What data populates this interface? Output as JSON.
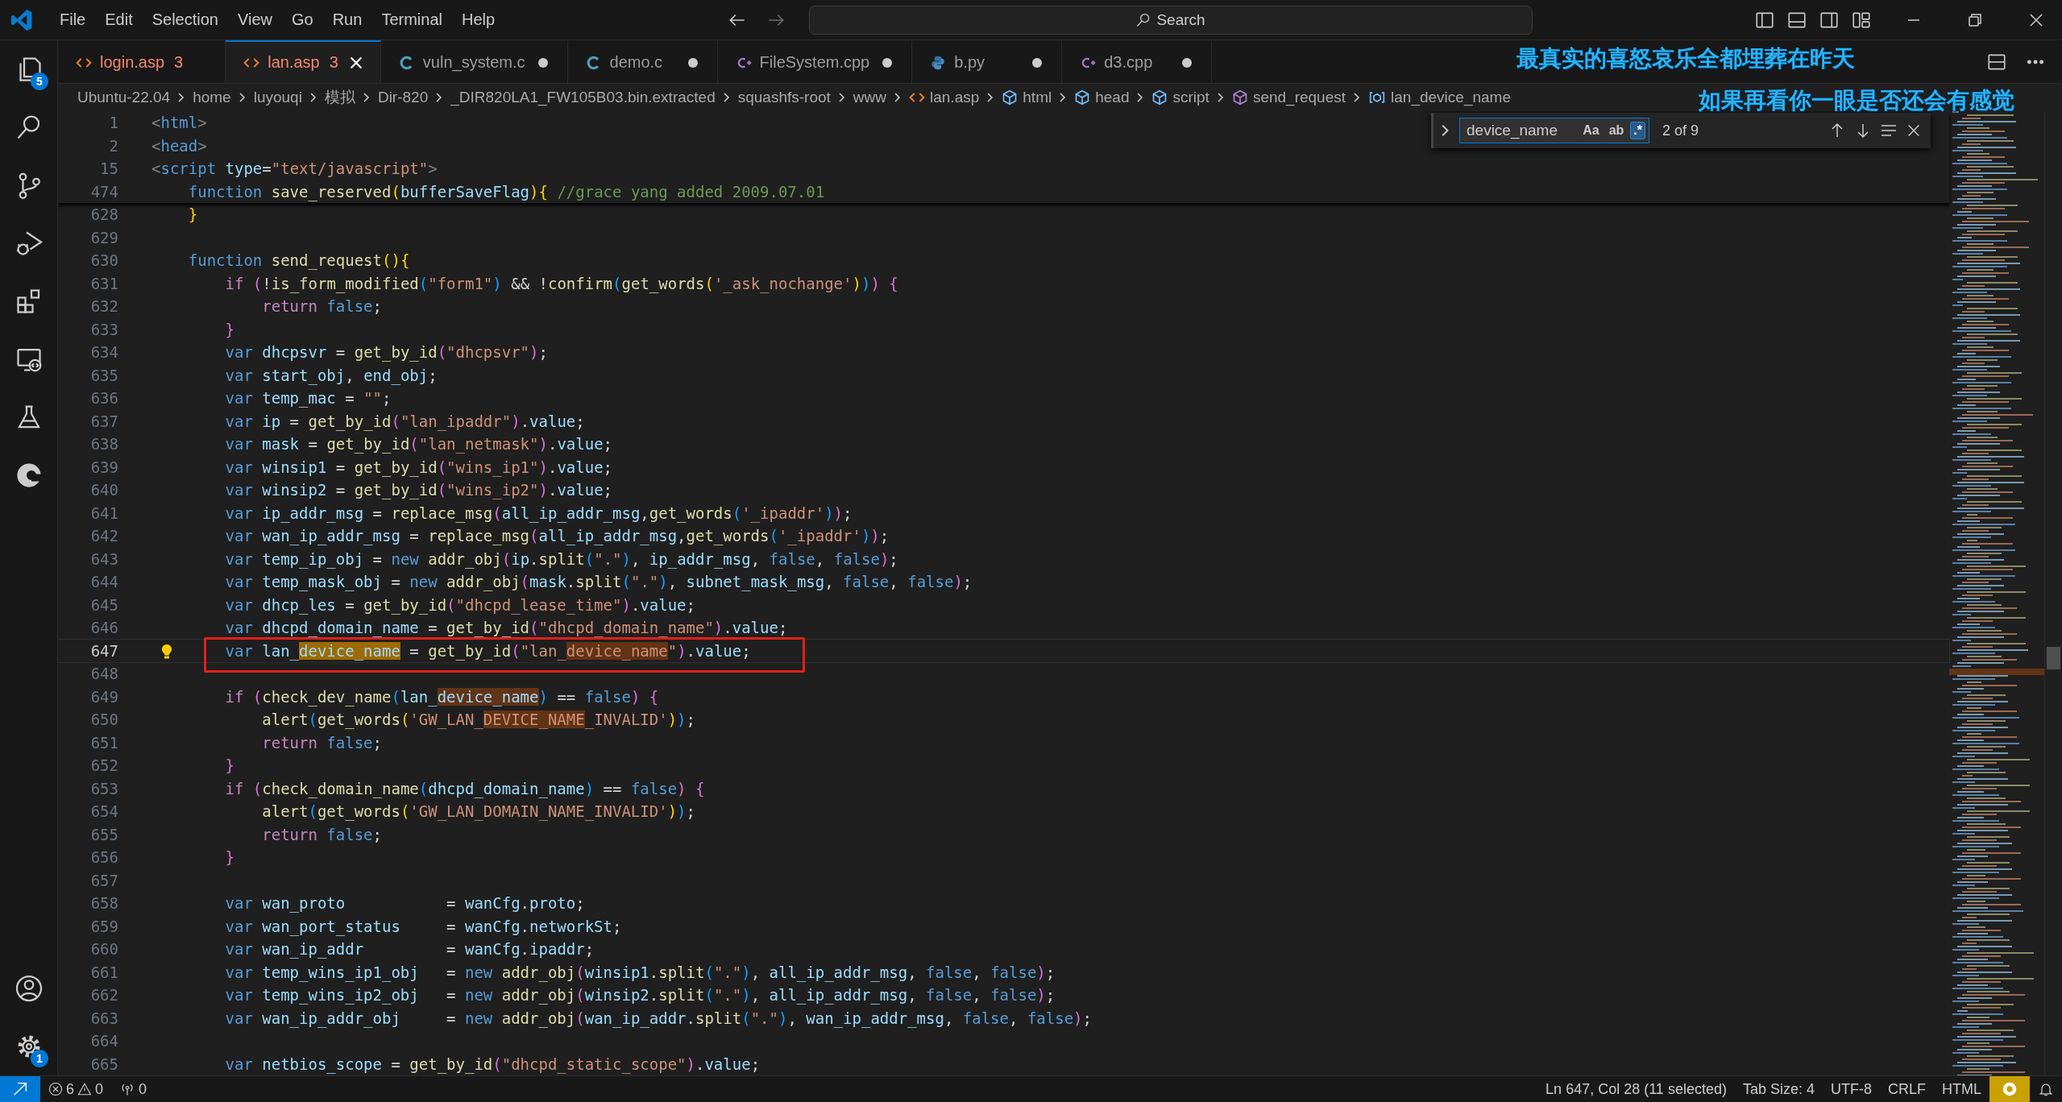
{
  "menu": [
    "File",
    "Edit",
    "Selection",
    "View",
    "Go",
    "Run",
    "Terminal",
    "Help"
  ],
  "command_center": {
    "placeholder": "Search"
  },
  "activity_bar": {
    "items": [
      {
        "kind": "explorer",
        "badge": "5"
      },
      {
        "kind": "search"
      },
      {
        "kind": "source-control"
      },
      {
        "kind": "run-debug"
      },
      {
        "kind": "extensions"
      },
      {
        "kind": "remote"
      },
      {
        "kind": "testing"
      },
      {
        "kind": "round"
      }
    ],
    "bottom": [
      {
        "kind": "account"
      },
      {
        "kind": "settings",
        "badge": "1"
      }
    ]
  },
  "tabs": [
    {
      "label": "login.asp",
      "kind": "html",
      "problems": "3",
      "modified": false,
      "selected": false,
      "has_errors": true
    },
    {
      "label": "lan.asp",
      "kind": "html",
      "problems": "3",
      "modified": false,
      "selected": true,
      "has_errors": true
    },
    {
      "label": "vuln_system.c",
      "kind": "c",
      "modified": true,
      "selected": false,
      "has_errors": false
    },
    {
      "label": "demo.c",
      "kind": "c",
      "modified": true,
      "selected": false,
      "has_errors": false
    },
    {
      "label": "FileSystem.cpp",
      "kind": "cpp",
      "modified": true,
      "selected": false,
      "has_errors": false
    },
    {
      "label": "b.py",
      "kind": "python",
      "modified": true,
      "selected": false,
      "has_errors": false
    },
    {
      "label": "d3.cpp",
      "kind": "cpp",
      "modified": true,
      "selected": false,
      "has_errors": false
    }
  ],
  "breadcrumbs": [
    {
      "text": "Ubuntu-22.04",
      "kind": "folder"
    },
    {
      "text": "home",
      "kind": "folder"
    },
    {
      "text": "luyouqi",
      "kind": "folder"
    },
    {
      "text": "模拟",
      "kind": "folder"
    },
    {
      "text": "Dir-820",
      "kind": "folder"
    },
    {
      "text": "_DIR820LA1_FW105B03.bin.extracted",
      "kind": "folder"
    },
    {
      "text": "squashfs-root",
      "kind": "folder"
    },
    {
      "text": "www",
      "kind": "folder"
    },
    {
      "text": "lan.asp",
      "kind": "html"
    },
    {
      "text": "html",
      "kind": "element"
    },
    {
      "text": "head",
      "kind": "element"
    },
    {
      "text": "script",
      "kind": "element"
    },
    {
      "text": "send_request",
      "kind": "method"
    },
    {
      "text": "lan_device_name",
      "kind": "variable"
    }
  ],
  "lyrics": [
    "最真实的喜怒哀乐全都埋葬在昨天",
    "如果再看你一眼是否还会有感觉"
  ],
  "find": {
    "value": "device_name",
    "toggles": [
      {
        "label": "Aa",
        "on": false
      },
      {
        "label": "ab",
        "on": false
      },
      {
        "label": ".*",
        "on": true
      }
    ],
    "count": "2 of 9"
  },
  "editor": {
    "sticky_lines": [
      {
        "n": "1",
        "tokens": [
          {
            "kind": "tagp",
            "text": "<"
          },
          {
            "kind": "tag",
            "text": "html"
          },
          {
            "kind": "tagp",
            "text": ">"
          }
        ]
      },
      {
        "n": "2",
        "tokens": [
          {
            "kind": "tagp",
            "text": "<"
          },
          {
            "kind": "tag",
            "text": "head"
          },
          {
            "kind": "tagp",
            "text": ">"
          }
        ]
      },
      {
        "n": "15",
        "tokens": [
          {
            "kind": "tagp",
            "text": "<"
          },
          {
            "kind": "tag",
            "text": "script "
          },
          {
            "kind": "attr",
            "text": "type"
          },
          {
            "kind": "p",
            "text": "="
          },
          {
            "kind": "str",
            "text": "\"text/javascript\""
          },
          {
            "kind": "tagp",
            "text": ">"
          }
        ]
      },
      {
        "n": "474",
        "tokens": [
          {
            "kind": "kw",
            "text": "    function "
          },
          {
            "kind": "fn",
            "text": "save_reserved"
          },
          {
            "kind": "b1",
            "text": "("
          },
          {
            "kind": "var",
            "text": "bufferSaveFlag"
          },
          {
            "kind": "b1",
            "text": "){ "
          },
          {
            "kind": "cm",
            "text": "//grace yang added 2009.07.01"
          }
        ]
      }
    ],
    "lines": [
      {
        "n": "628",
        "current": false,
        "tokens": [
          {
            "kind": "b1",
            "text": "    }"
          }
        ]
      },
      {
        "n": "629",
        "current": false
      },
      {
        "n": "630",
        "current": false,
        "tokens": [
          {
            "kind": "kw",
            "text": "    function "
          },
          {
            "kind": "fn",
            "text": "send_request"
          },
          {
            "kind": "b1",
            "text": "(){"
          }
        ]
      },
      {
        "n": "631",
        "current": false,
        "tokens": [
          {
            "kind": "ctl",
            "text": "        if "
          },
          {
            "kind": "b2",
            "text": "("
          },
          {
            "kind": "p",
            "text": "!"
          },
          {
            "kind": "fn",
            "text": "is_form_modified"
          },
          {
            "kind": "b3",
            "text": "("
          },
          {
            "kind": "str",
            "text": "\"form1\""
          },
          {
            "kind": "b3",
            "text": ")"
          },
          {
            "kind": "p",
            "text": " && !"
          },
          {
            "kind": "fn",
            "text": "confirm"
          },
          {
            "kind": "b3",
            "text": "("
          },
          {
            "kind": "fn",
            "text": "get_words"
          },
          {
            "kind": "b1",
            "text": "("
          },
          {
            "kind": "str",
            "text": "'_ask_nochange'"
          },
          {
            "kind": "b1",
            "text": ")"
          },
          {
            "kind": "b3",
            "text": ")"
          },
          {
            "kind": "b2",
            "text": ") {"
          }
        ]
      },
      {
        "n": "632",
        "current": false,
        "tokens": [
          {
            "kind": "ctl",
            "text": "            return "
          },
          {
            "kind": "const",
            "text": "false"
          },
          {
            "kind": "p",
            "text": ";"
          }
        ]
      },
      {
        "n": "633",
        "current": false,
        "tokens": [
          {
            "kind": "b2",
            "text": "        }"
          }
        ]
      },
      {
        "n": "634",
        "current": false,
        "tokens": [
          {
            "kind": "kw",
            "text": "        var "
          },
          {
            "kind": "var",
            "text": "dhcpsvr"
          },
          {
            "kind": "p",
            "text": " = "
          },
          {
            "kind": "fn",
            "text": "get_by_id"
          },
          {
            "kind": "b2",
            "text": "("
          },
          {
            "kind": "str",
            "text": "\"dhcpsvr\""
          },
          {
            "kind": "b2",
            "text": ")"
          },
          {
            "kind": "p",
            "text": ";"
          }
        ]
      },
      {
        "n": "635",
        "current": false,
        "tokens": [
          {
            "kind": "kw",
            "text": "        var "
          },
          {
            "kind": "var",
            "text": "start_obj"
          },
          {
            "kind": "p",
            "text": ", "
          },
          {
            "kind": "var",
            "text": "end_obj"
          },
          {
            "kind": "p",
            "text": ";"
          }
        ]
      },
      {
        "n": "636",
        "current": false,
        "tokens": [
          {
            "kind": "kw",
            "text": "        var "
          },
          {
            "kind": "var",
            "text": "temp_mac"
          },
          {
            "kind": "p",
            "text": " = "
          },
          {
            "kind": "str",
            "text": "\"\""
          },
          {
            "kind": "p",
            "text": ";"
          }
        ]
      },
      {
        "n": "637",
        "current": false,
        "tokens": [
          {
            "kind": "kw",
            "text": "        var "
          },
          {
            "kind": "var",
            "text": "ip"
          },
          {
            "kind": "p",
            "text": " = "
          },
          {
            "kind": "fn",
            "text": "get_by_id"
          },
          {
            "kind": "b2",
            "text": "("
          },
          {
            "kind": "str",
            "text": "\"lan_ipaddr\""
          },
          {
            "kind": "b2",
            "text": ")"
          },
          {
            "kind": "p",
            "text": "."
          },
          {
            "kind": "var",
            "text": "value"
          },
          {
            "kind": "p",
            "text": ";"
          }
        ]
      },
      {
        "n": "638",
        "current": false,
        "tokens": [
          {
            "kind": "kw",
            "text": "        var "
          },
          {
            "kind": "var",
            "text": "mask"
          },
          {
            "kind": "p",
            "text": " = "
          },
          {
            "kind": "fn",
            "text": "get_by_id"
          },
          {
            "kind": "b2",
            "text": "("
          },
          {
            "kind": "str",
            "text": "\"lan_netmask\""
          },
          {
            "kind": "b2",
            "text": ")"
          },
          {
            "kind": "p",
            "text": "."
          },
          {
            "kind": "var",
            "text": "value"
          },
          {
            "kind": "p",
            "text": ";"
          }
        ]
      },
      {
        "n": "639",
        "current": false,
        "tokens": [
          {
            "kind": "kw",
            "text": "        var "
          },
          {
            "kind": "var",
            "text": "winsip1"
          },
          {
            "kind": "p",
            "text": " = "
          },
          {
            "kind": "fn",
            "text": "get_by_id"
          },
          {
            "kind": "b2",
            "text": "("
          },
          {
            "kind": "str",
            "text": "\"wins_ip1\""
          },
          {
            "kind": "b2",
            "text": ")"
          },
          {
            "kind": "p",
            "text": "."
          },
          {
            "kind": "var",
            "text": "value"
          },
          {
            "kind": "p",
            "text": ";"
          }
        ]
      },
      {
        "n": "640",
        "current": false,
        "tokens": [
          {
            "kind": "kw",
            "text": "        var "
          },
          {
            "kind": "var",
            "text": "winsip2"
          },
          {
            "kind": "p",
            "text": " = "
          },
          {
            "kind": "fn",
            "text": "get_by_id"
          },
          {
            "kind": "b2",
            "text": "("
          },
          {
            "kind": "str",
            "text": "\"wins_ip2\""
          },
          {
            "kind": "b2",
            "text": ")"
          },
          {
            "kind": "p",
            "text": "."
          },
          {
            "kind": "var",
            "text": "value"
          },
          {
            "kind": "p",
            "text": ";"
          }
        ]
      },
      {
        "n": "641",
        "current": false,
        "tokens": [
          {
            "kind": "kw",
            "text": "        var "
          },
          {
            "kind": "var",
            "text": "ip_addr_msg"
          },
          {
            "kind": "p",
            "text": " = "
          },
          {
            "kind": "fn",
            "text": "replace_msg"
          },
          {
            "kind": "b2",
            "text": "("
          },
          {
            "kind": "var",
            "text": "all_ip_addr_msg"
          },
          {
            "kind": "p",
            "text": ","
          },
          {
            "kind": "fn",
            "text": "get_words"
          },
          {
            "kind": "b3",
            "text": "("
          },
          {
            "kind": "str",
            "text": "'_ipaddr'"
          },
          {
            "kind": "b3",
            "text": ")"
          },
          {
            "kind": "b2",
            "text": ")"
          },
          {
            "kind": "p",
            "text": ";"
          }
        ]
      },
      {
        "n": "642",
        "current": false,
        "tokens": [
          {
            "kind": "kw",
            "text": "        var "
          },
          {
            "kind": "var",
            "text": "wan_ip_addr_msg"
          },
          {
            "kind": "p",
            "text": " = "
          },
          {
            "kind": "fn",
            "text": "replace_msg"
          },
          {
            "kind": "b2",
            "text": "("
          },
          {
            "kind": "var",
            "text": "all_ip_addr_msg"
          },
          {
            "kind": "p",
            "text": ","
          },
          {
            "kind": "fn",
            "text": "get_words"
          },
          {
            "kind": "b3",
            "text": "("
          },
          {
            "kind": "str",
            "text": "'_ipaddr'"
          },
          {
            "kind": "b3",
            "text": ")"
          },
          {
            "kind": "b2",
            "text": ")"
          },
          {
            "kind": "p",
            "text": ";"
          }
        ]
      },
      {
        "n": "643",
        "current": false,
        "tokens": [
          {
            "kind": "kw",
            "text": "        var "
          },
          {
            "kind": "var",
            "text": "temp_ip_obj"
          },
          {
            "kind": "p",
            "text": " = "
          },
          {
            "kind": "kw",
            "text": "new "
          },
          {
            "kind": "fn",
            "text": "addr_obj"
          },
          {
            "kind": "b2",
            "text": "("
          },
          {
            "kind": "var",
            "text": "ip"
          },
          {
            "kind": "p",
            "text": "."
          },
          {
            "kind": "fn",
            "text": "split"
          },
          {
            "kind": "b3",
            "text": "("
          },
          {
            "kind": "str",
            "text": "\".\""
          },
          {
            "kind": "b3",
            "text": ")"
          },
          {
            "kind": "p",
            "text": ", "
          },
          {
            "kind": "var",
            "text": "ip_addr_msg"
          },
          {
            "kind": "p",
            "text": ", "
          },
          {
            "kind": "const",
            "text": "false"
          },
          {
            "kind": "p",
            "text": ", "
          },
          {
            "kind": "const",
            "text": "false"
          },
          {
            "kind": "b2",
            "text": ")"
          },
          {
            "kind": "p",
            "text": ";"
          }
        ]
      },
      {
        "n": "644",
        "current": false,
        "tokens": [
          {
            "kind": "kw",
            "text": "        var "
          },
          {
            "kind": "var",
            "text": "temp_mask_obj"
          },
          {
            "kind": "p",
            "text": " = "
          },
          {
            "kind": "kw",
            "text": "new "
          },
          {
            "kind": "fn",
            "text": "addr_obj"
          },
          {
            "kind": "b2",
            "text": "("
          },
          {
            "kind": "var",
            "text": "mask"
          },
          {
            "kind": "p",
            "text": "."
          },
          {
            "kind": "fn",
            "text": "split"
          },
          {
            "kind": "b3",
            "text": "("
          },
          {
            "kind": "str",
            "text": "\".\""
          },
          {
            "kind": "b3",
            "text": ")"
          },
          {
            "kind": "p",
            "text": ", "
          },
          {
            "kind": "var",
            "text": "subnet_mask_msg"
          },
          {
            "kind": "p",
            "text": ", "
          },
          {
            "kind": "const",
            "text": "false"
          },
          {
            "kind": "p",
            "text": ", "
          },
          {
            "kind": "const",
            "text": "false"
          },
          {
            "kind": "b2",
            "text": ")"
          },
          {
            "kind": "p",
            "text": ";"
          }
        ]
      },
      {
        "n": "645",
        "current": false,
        "tokens": [
          {
            "kind": "kw",
            "text": "        var "
          },
          {
            "kind": "var",
            "text": "dhcp_les"
          },
          {
            "kind": "p",
            "text": " = "
          },
          {
            "kind": "fn",
            "text": "get_by_id"
          },
          {
            "kind": "b2",
            "text": "("
          },
          {
            "kind": "str",
            "text": "\"dhcpd_lease_time\""
          },
          {
            "kind": "b2",
            "text": ")"
          },
          {
            "kind": "p",
            "text": "."
          },
          {
            "kind": "var",
            "text": "value"
          },
          {
            "kind": "p",
            "text": ";"
          }
        ]
      },
      {
        "n": "646",
        "current": false,
        "tokens": [
          {
            "kind": "kw",
            "text": "        var "
          },
          {
            "kind": "var",
            "text": "dhcpd_domain_name"
          },
          {
            "kind": "p",
            "text": " = "
          },
          {
            "kind": "fn",
            "text": "get_by_id"
          },
          {
            "kind": "b2",
            "text": "("
          },
          {
            "kind": "str",
            "text": "\"dhcpd_domain_name\""
          },
          {
            "kind": "b2",
            "text": ")"
          },
          {
            "kind": "p",
            "text": "."
          },
          {
            "kind": "var",
            "text": "value"
          },
          {
            "kind": "p",
            "text": ";"
          }
        ]
      },
      {
        "n": "647",
        "current": true,
        "boxed": true,
        "lightbulb": true,
        "tokens": [
          {
            "kind": "kw",
            "text": "        var "
          },
          {
            "kind": "var",
            "text": "lan_"
          },
          {
            "kind": "var",
            "text": "device_name",
            "match": true,
            "selected": true
          },
          {
            "kind": "p",
            "text": " = "
          },
          {
            "kind": "fn",
            "text": "get_by_id"
          },
          {
            "kind": "b2",
            "text": "("
          },
          {
            "kind": "str",
            "text": "\"lan_"
          },
          {
            "kind": "str",
            "text": "device_name",
            "match": true,
            "selected": false
          },
          {
            "kind": "str",
            "text": "\""
          },
          {
            "kind": "b2",
            "text": ")"
          },
          {
            "kind": "p",
            "text": "."
          },
          {
            "kind": "var",
            "text": "value"
          },
          {
            "kind": "p",
            "text": ";"
          }
        ]
      },
      {
        "n": "648",
        "current": false
      },
      {
        "n": "649",
        "current": false,
        "tokens": [
          {
            "kind": "ctl",
            "text": "        if "
          },
          {
            "kind": "b2",
            "text": "("
          },
          {
            "kind": "fn",
            "text": "check_dev_name"
          },
          {
            "kind": "b3",
            "text": "("
          },
          {
            "kind": "var",
            "text": "lan_"
          },
          {
            "kind": "var",
            "text": "device_name",
            "match": true,
            "selected": false
          },
          {
            "kind": "b3",
            "text": ")"
          },
          {
            "kind": "p",
            "text": " == "
          },
          {
            "kind": "const",
            "text": "false"
          },
          {
            "kind": "b2",
            "text": ") {"
          }
        ]
      },
      {
        "n": "650",
        "current": false,
        "tokens": [
          {
            "kind": "fn",
            "text": "            alert"
          },
          {
            "kind": "b3",
            "text": "("
          },
          {
            "kind": "fn",
            "text": "get_words"
          },
          {
            "kind": "b1",
            "text": "("
          },
          {
            "kind": "str",
            "text": "'GW_LAN_"
          },
          {
            "kind": "str",
            "text": "DEVICE_NAME",
            "match": true,
            "selected": false
          },
          {
            "kind": "str",
            "text": "_INVALID'"
          },
          {
            "kind": "b1",
            "text": ")"
          },
          {
            "kind": "b3",
            "text": ")"
          },
          {
            "kind": "p",
            "text": ";"
          }
        ]
      },
      {
        "n": "651",
        "current": false,
        "tokens": [
          {
            "kind": "ctl",
            "text": "            return "
          },
          {
            "kind": "const",
            "text": "false"
          },
          {
            "kind": "p",
            "text": ";"
          }
        ]
      },
      {
        "n": "652",
        "current": false,
        "tokens": [
          {
            "kind": "b2",
            "text": "        }"
          }
        ]
      },
      {
        "n": "653",
        "current": false,
        "tokens": [
          {
            "kind": "ctl",
            "text": "        if "
          },
          {
            "kind": "b2",
            "text": "("
          },
          {
            "kind": "fn",
            "text": "check_domain_name"
          },
          {
            "kind": "b3",
            "text": "("
          },
          {
            "kind": "var",
            "text": "dhcpd_domain_name"
          },
          {
            "kind": "b3",
            "text": ")"
          },
          {
            "kind": "p",
            "text": " == "
          },
          {
            "kind": "const",
            "text": "false"
          },
          {
            "kind": "b2",
            "text": ") {"
          }
        ]
      },
      {
        "n": "654",
        "current": false,
        "tokens": [
          {
            "kind": "fn",
            "text": "            alert"
          },
          {
            "kind": "b3",
            "text": "("
          },
          {
            "kind": "fn",
            "text": "get_words"
          },
          {
            "kind": "b1",
            "text": "("
          },
          {
            "kind": "str",
            "text": "'GW_LAN_DOMAIN_NAME_INVALID'"
          },
          {
            "kind": "b1",
            "text": ")"
          },
          {
            "kind": "b3",
            "text": ")"
          },
          {
            "kind": "p",
            "text": ";"
          }
        ]
      },
      {
        "n": "655",
        "current": false,
        "tokens": [
          {
            "kind": "ctl",
            "text": "            return "
          },
          {
            "kind": "const",
            "text": "false"
          },
          {
            "kind": "p",
            "text": ";"
          }
        ]
      },
      {
        "n": "656",
        "current": false,
        "tokens": [
          {
            "kind": "b2",
            "text": "        }"
          }
        ]
      },
      {
        "n": "657",
        "current": false
      },
      {
        "n": "658",
        "current": false,
        "tokens": [
          {
            "kind": "kw",
            "text": "        var "
          },
          {
            "kind": "var",
            "text": "wan_proto"
          },
          {
            "kind": "p",
            "text": "           = "
          },
          {
            "kind": "var",
            "text": "wanCfg"
          },
          {
            "kind": "p",
            "text": "."
          },
          {
            "kind": "var",
            "text": "proto"
          },
          {
            "kind": "p",
            "text": ";"
          }
        ]
      },
      {
        "n": "659",
        "current": false,
        "tokens": [
          {
            "kind": "kw",
            "text": "        var "
          },
          {
            "kind": "var",
            "text": "wan_port_status"
          },
          {
            "kind": "p",
            "text": "     = "
          },
          {
            "kind": "var",
            "text": "wanCfg"
          },
          {
            "kind": "p",
            "text": "."
          },
          {
            "kind": "var",
            "text": "networkSt"
          },
          {
            "kind": "p",
            "text": ";"
          }
        ]
      },
      {
        "n": "660",
        "current": false,
        "tokens": [
          {
            "kind": "kw",
            "text": "        var "
          },
          {
            "kind": "var",
            "text": "wan_ip_addr"
          },
          {
            "kind": "p",
            "text": "         = "
          },
          {
            "kind": "var",
            "text": "wanCfg"
          },
          {
            "kind": "p",
            "text": "."
          },
          {
            "kind": "var",
            "text": "ipaddr"
          },
          {
            "kind": "p",
            "text": ";"
          }
        ]
      },
      {
        "n": "661",
        "current": false,
        "tokens": [
          {
            "kind": "kw",
            "text": "        var "
          },
          {
            "kind": "var",
            "text": "temp_wins_ip1_obj"
          },
          {
            "kind": "p",
            "text": "   = "
          },
          {
            "kind": "kw",
            "text": "new "
          },
          {
            "kind": "fn",
            "text": "addr_obj"
          },
          {
            "kind": "b2",
            "text": "("
          },
          {
            "kind": "var",
            "text": "winsip1"
          },
          {
            "kind": "p",
            "text": "."
          },
          {
            "kind": "fn",
            "text": "split"
          },
          {
            "kind": "b3",
            "text": "("
          },
          {
            "kind": "str",
            "text": "\".\""
          },
          {
            "kind": "b3",
            "text": ")"
          },
          {
            "kind": "p",
            "text": ", "
          },
          {
            "kind": "var",
            "text": "all_ip_addr_msg"
          },
          {
            "kind": "p",
            "text": ", "
          },
          {
            "kind": "const",
            "text": "false"
          },
          {
            "kind": "p",
            "text": ", "
          },
          {
            "kind": "const",
            "text": "false"
          },
          {
            "kind": "b2",
            "text": ")"
          },
          {
            "kind": "p",
            "text": ";"
          }
        ]
      },
      {
        "n": "662",
        "current": false,
        "tokens": [
          {
            "kind": "kw",
            "text": "        var "
          },
          {
            "kind": "var",
            "text": "temp_wins_ip2_obj"
          },
          {
            "kind": "p",
            "text": "   = "
          },
          {
            "kind": "kw",
            "text": "new "
          },
          {
            "kind": "fn",
            "text": "addr_obj"
          },
          {
            "kind": "b2",
            "text": "("
          },
          {
            "kind": "var",
            "text": "winsip2"
          },
          {
            "kind": "p",
            "text": "."
          },
          {
            "kind": "fn",
            "text": "split"
          },
          {
            "kind": "b3",
            "text": "("
          },
          {
            "kind": "str",
            "text": "\".\""
          },
          {
            "kind": "b3",
            "text": ")"
          },
          {
            "kind": "p",
            "text": ", "
          },
          {
            "kind": "var",
            "text": "all_ip_addr_msg"
          },
          {
            "kind": "p",
            "text": ", "
          },
          {
            "kind": "const",
            "text": "false"
          },
          {
            "kind": "p",
            "text": ", "
          },
          {
            "kind": "const",
            "text": "false"
          },
          {
            "kind": "b2",
            "text": ")"
          },
          {
            "kind": "p",
            "text": ";"
          }
        ]
      },
      {
        "n": "663",
        "current": false,
        "tokens": [
          {
            "kind": "kw",
            "text": "        var "
          },
          {
            "kind": "var",
            "text": "wan_ip_addr_obj"
          },
          {
            "kind": "p",
            "text": "     = "
          },
          {
            "kind": "kw",
            "text": "new "
          },
          {
            "kind": "fn",
            "text": "addr_obj"
          },
          {
            "kind": "b2",
            "text": "("
          },
          {
            "kind": "var",
            "text": "wan_ip_addr"
          },
          {
            "kind": "p",
            "text": "."
          },
          {
            "kind": "fn",
            "text": "split"
          },
          {
            "kind": "b3",
            "text": "("
          },
          {
            "kind": "str",
            "text": "\".\""
          },
          {
            "kind": "b3",
            "text": ")"
          },
          {
            "kind": "p",
            "text": ", "
          },
          {
            "kind": "var",
            "text": "wan_ip_addr_msg"
          },
          {
            "kind": "p",
            "text": ", "
          },
          {
            "kind": "const",
            "text": "false"
          },
          {
            "kind": "p",
            "text": ", "
          },
          {
            "kind": "const",
            "text": "false"
          },
          {
            "kind": "b2",
            "text": ")"
          },
          {
            "kind": "p",
            "text": ";"
          }
        ]
      },
      {
        "n": "664",
        "current": false
      },
      {
        "n": "665",
        "current": false,
        "tokens": [
          {
            "kind": "kw",
            "text": "        var "
          },
          {
            "kind": "var",
            "text": "netbios_scope"
          },
          {
            "kind": "p",
            "text": " = "
          },
          {
            "kind": "fn",
            "text": "get_by_id"
          },
          {
            "kind": "b2",
            "text": "("
          },
          {
            "kind": "str",
            "text": "\"dhcpd_static_scope\""
          },
          {
            "kind": "b2",
            "text": ")"
          },
          {
            "kind": "p",
            "text": "."
          },
          {
            "kind": "var",
            "text": "value"
          },
          {
            "kind": "p",
            "text": ";"
          }
        ]
      }
    ]
  },
  "status_bar": {
    "errors": "6",
    "warnings": "0",
    "ports": "0",
    "right": [
      "Ln 647, Col 28 (11 selected)",
      "Tab Size: 4",
      "UTF-8",
      "CRLF",
      "HTML"
    ]
  }
}
